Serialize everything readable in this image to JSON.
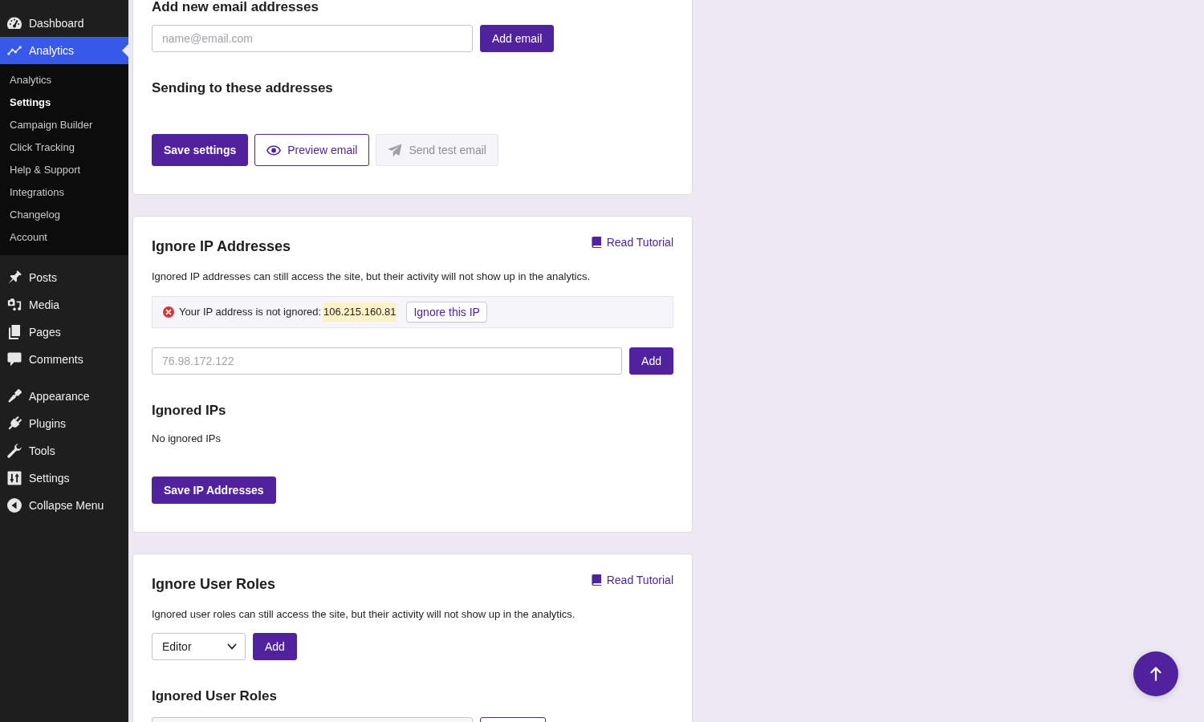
{
  "sidebar": {
    "groups": [
      {
        "items": [
          {
            "label": "Dashboard",
            "selected": false
          },
          {
            "label": "Analytics",
            "selected": true,
            "submenu": [
              {
                "label": "Analytics",
                "selected": false
              },
              {
                "label": "Settings",
                "selected": true
              },
              {
                "label": "Campaign Builder",
                "selected": false
              },
              {
                "label": "Click Tracking",
                "selected": false
              },
              {
                "label": "Help & Support",
                "selected": false
              },
              {
                "label": "Integrations",
                "selected": false
              },
              {
                "label": "Changelog",
                "selected": false
              },
              {
                "label": "Account",
                "selected": false
              }
            ]
          }
        ]
      },
      {
        "items": [
          {
            "label": "Posts",
            "selected": false
          },
          {
            "label": "Media",
            "selected": false
          },
          {
            "label": "Pages",
            "selected": false
          },
          {
            "label": "Comments",
            "selected": false
          }
        ]
      },
      {
        "items": [
          {
            "label": "Appearance",
            "selected": false
          },
          {
            "label": "Plugins",
            "selected": false
          },
          {
            "label": "Tools",
            "selected": false
          },
          {
            "label": "Settings",
            "selected": false
          }
        ]
      }
    ],
    "collapse_label": "Collapse Menu"
  },
  "email_card": {
    "heading": "Add new email addresses",
    "email_field": {
      "placeholder": "name@email.com"
    },
    "add_button": "Add email",
    "list_heading": "Sending to these addresses",
    "buttons": [
      {
        "label": "Save settings",
        "kind": "primary",
        "disabled": false
      },
      {
        "label": "Preview email",
        "kind": "outline",
        "disabled": false
      },
      {
        "label": "Send test email",
        "kind": "light",
        "disabled": true
      }
    ]
  },
  "ip_card": {
    "title": "Ignore IP Addresses",
    "tutorial_link": "Read Tutorial",
    "description": "Ignored IP addresses can still access the site, but their activity will not show up in the analytics.",
    "status": {
      "ignored": false,
      "message": "Your IP address is not ignored:",
      "ip": "106.215.160.81",
      "action": "Ignore this IP"
    },
    "ip_field": {
      "placeholder": "76.98.172.122"
    },
    "add_button": "Add",
    "list_heading": "Ignored IPs",
    "empty_text": "No ignored IPs",
    "save_button": "Save IP Addresses"
  },
  "roles_card": {
    "title": "Ignore User Roles",
    "tutorial_link": "Read Tutorial",
    "description": "Ignored user roles can still access the site, but their activity will not show up in the analytics.",
    "role_select": {
      "value": "Editor"
    },
    "add_button": "Add",
    "list_heading": "Ignored User Roles"
  }
}
